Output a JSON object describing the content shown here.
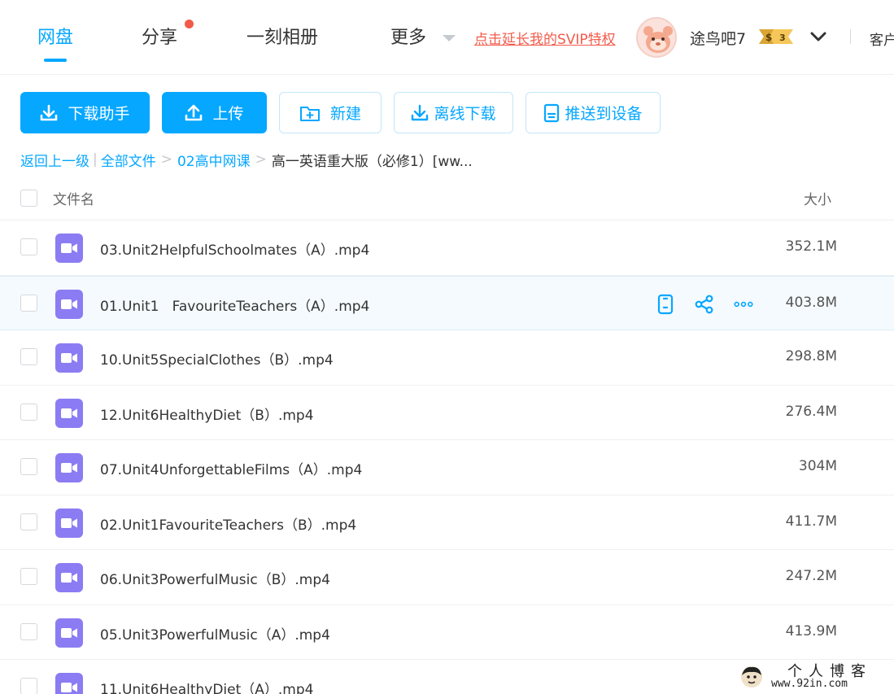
{
  "nav": {
    "tabs": [
      {
        "label": "网盘",
        "active": true
      },
      {
        "label": "分享",
        "has_notification": true
      },
      {
        "label": "一刻相册"
      },
      {
        "label": "更多",
        "has_dropdown": true
      }
    ],
    "svip_link": "点击延长我的SVIP特权",
    "username": "途鸟吧7",
    "vip_level": "3",
    "client_label": "客户"
  },
  "toolbar": {
    "download_helper": "下载助手",
    "upload": "上传",
    "new_folder": "新建",
    "offline_download": "离线下载",
    "push_to_device": "推送到设备"
  },
  "breadcrumb": {
    "back": "返回上一级",
    "all_files": "全部文件",
    "folder": "02高中网课",
    "current": "高一英语重大版（必修1）[ww..."
  },
  "table": {
    "header_name": "文件名",
    "header_size": "大小",
    "files": [
      {
        "name": "03.Unit2HelpfulSchoolmates（A）.mp4",
        "size": "352.1M"
      },
      {
        "name": "01.Unit1   FavouriteTeachers（A）.mp4",
        "size": "403.8M",
        "hover": true
      },
      {
        "name": "10.Unit5SpecialClothes（B）.mp4",
        "size": "298.8M"
      },
      {
        "name": "12.Unit6HealthyDiet（B）.mp4",
        "size": "276.4M"
      },
      {
        "name": "07.Unit4UnforgettableFilms（A）.mp4",
        "size": "304M"
      },
      {
        "name": "02.Unit1FavouriteTeachers（B）.mp4",
        "size": "411.7M"
      },
      {
        "name": "06.Unit3PowerfulMusic（B）.mp4",
        "size": "247.2M"
      },
      {
        "name": "05.Unit3PowerfulMusic（A）.mp4",
        "size": "413.9M"
      },
      {
        "name": "11.Unit6HealthyDiet（A）.mp4",
        "size": ""
      }
    ]
  },
  "watermark": {
    "title": "个人博客",
    "url": "www.92in.com"
  },
  "colors": {
    "accent": "#06a7ff",
    "svip": "#f25b4b",
    "video_icon": "#8b7cf3"
  }
}
